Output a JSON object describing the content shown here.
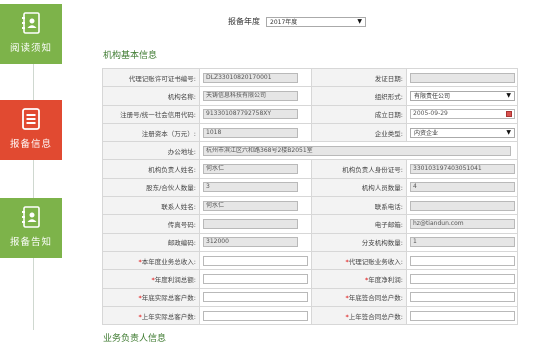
{
  "sidebar": {
    "items": [
      {
        "label": "阅读须知",
        "icon": "contact-book-icon"
      },
      {
        "label": "报备信息",
        "icon": "list-document-icon"
      },
      {
        "label": "报备告知",
        "icon": "contact-book-icon"
      }
    ]
  },
  "header": {
    "year_label": "报备年度",
    "year_value": "2017年度"
  },
  "section1": {
    "title": "机构基本信息"
  },
  "section2": {
    "title": "业务负责人信息"
  },
  "form": {
    "rows": [
      {
        "l1": "代理记账许可证书编号:",
        "v1": "DLZ33010820170001",
        "l2": "发证日期:",
        "v2": ""
      },
      {
        "l1": "机构名称:",
        "v1": "天铸信息科技有限公司",
        "l2": "组织形式:",
        "v2": "有限责任公司"
      },
      {
        "l1": "注册号/统一社会信用代码:",
        "v1": "913301087792758XY",
        "l2": "成立日期:",
        "v2": "2005-09-29"
      },
      {
        "l1": "注册资本（万元）:",
        "v1": "1018",
        "l2": "企业类型:",
        "v2": "内资企业"
      },
      {
        "l1": "办公地址:",
        "v1": "杭州市滨江区六和路368号2楼B2051室"
      },
      {
        "l1": "机构负责人姓名:",
        "v1": "何水仁",
        "l2": "机构负责人身份证号:",
        "v2": "330103197403051041"
      },
      {
        "l1": "股东/合伙人数量:",
        "v1": "3",
        "l2": "机构人员数量:",
        "v2": "4"
      },
      {
        "l1": "联系人姓名:",
        "v1": "何水仁",
        "l2": "联系电话:",
        "v2": ""
      },
      {
        "l1": "传真号码:",
        "v1": "",
        "l2": "电子邮箱:",
        "v2": "hz@tiandun.com"
      },
      {
        "l1": "邮政编码:",
        "v1": "312000",
        "l2": "分支机构数量:",
        "v2": "1"
      },
      {
        "l1": "本年度业务总收入:",
        "v1": "",
        "l2": "代理记账业务收入:",
        "v2": ""
      },
      {
        "l1": "年度利润总额:",
        "v1": "",
        "l2": "年度净利润:",
        "v2": ""
      },
      {
        "l1": "年底实际总客户数:",
        "v1": "",
        "l2": "年底签合同总户数:",
        "v2": ""
      },
      {
        "l1": "上年实际总客户数:",
        "v1": "",
        "l2": "上年签合同总户数:",
        "v2": ""
      }
    ]
  },
  "colors": {
    "green": "#7db34a",
    "red": "#e14a31",
    "section_title": "#3d7a2f"
  }
}
